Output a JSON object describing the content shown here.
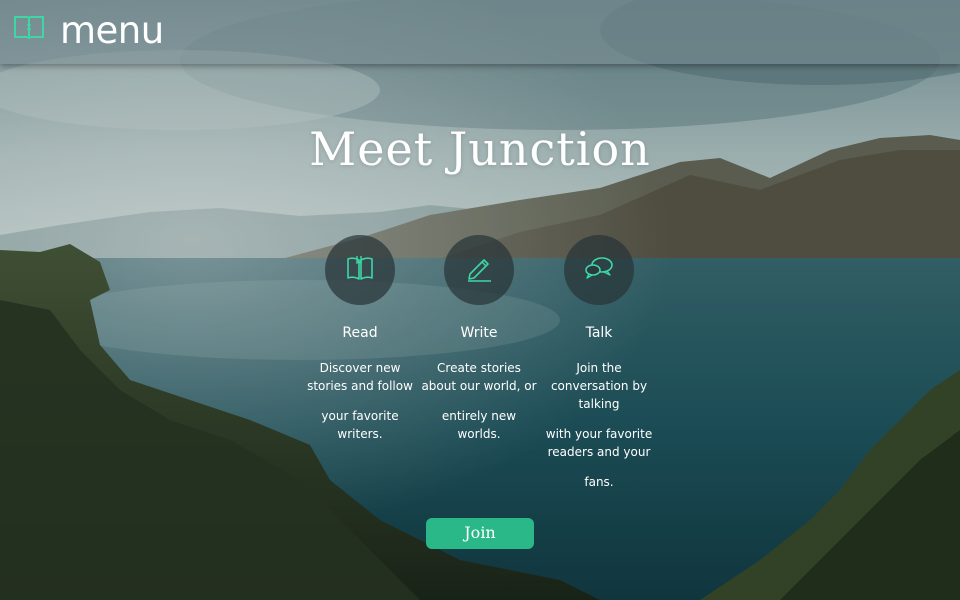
{
  "header": {
    "menu_label": "menu",
    "menu_icon": "book-icon"
  },
  "hero": {
    "title": "Meet Junction"
  },
  "features": [
    {
      "title": "Read",
      "icon": "book-icon",
      "desc_1": "Discover new stories and follow",
      "desc_2": "your favorite writers."
    },
    {
      "title": "Write",
      "icon": "pencil-icon",
      "desc_1": "Create stories about our world, or",
      "desc_2": "entirely new worlds."
    },
    {
      "title": "Talk",
      "icon": "chat-bubbles-icon",
      "desc_1": "Join the conversation by talking",
      "desc_2": "with your favorite readers and your",
      "desc_3": "fans."
    }
  ],
  "cta": {
    "join_label": "Join"
  },
  "colors": {
    "accent": "#2bb889",
    "icon_stroke": "#3fd6a6"
  }
}
